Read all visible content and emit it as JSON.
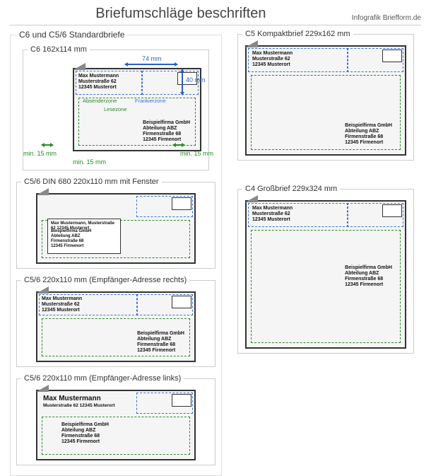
{
  "title": "Briefumschläge beschriften",
  "credit": "Infografik Briefform.de",
  "group_left_title": "C6 und C5/6 Standardbriefe",
  "dims": {
    "stamp_w": "74 mm",
    "stamp_h": "40 mm",
    "margin_left": "min. 15 mm",
    "margin_right": "min. 15 mm",
    "margin_bottom": "min. 15 mm"
  },
  "zones": {
    "absender": "Absenderzone",
    "frankier": "Frankierzone",
    "lese": "Lesezone"
  },
  "sender": {
    "line1": "Max Mustermann",
    "line2": "Musterstraße 62",
    "line3": "12345 Musterort"
  },
  "sender_one_line": "Max Mustermann, Musterstraße 62 12345 Musterort",
  "sender_big_subline": "Musterstraße 62 12345 Musterort",
  "recipient": {
    "line1": "Beispielfirma GmbH",
    "line2": "Abteilung ABZ",
    "line3": "Firmenstraße 68",
    "line4": "12345 Firmenort"
  },
  "cards": {
    "c6": {
      "title": "C6 162x114 mm"
    },
    "c56win": {
      "title": "C5/6 DIN 680 220x110 mm mit Fenster"
    },
    "c56r": {
      "title": "C5/6 220x110 mm (Empfänger-Adresse rechts)"
    },
    "c56l": {
      "title": "C5/6 220x110 mm (Empfänger-Adresse links)"
    },
    "c5": {
      "title": "C5 Kompaktbrief 229x162 mm"
    },
    "c4": {
      "title": "C4 Großbrief 229x324 mm"
    }
  }
}
